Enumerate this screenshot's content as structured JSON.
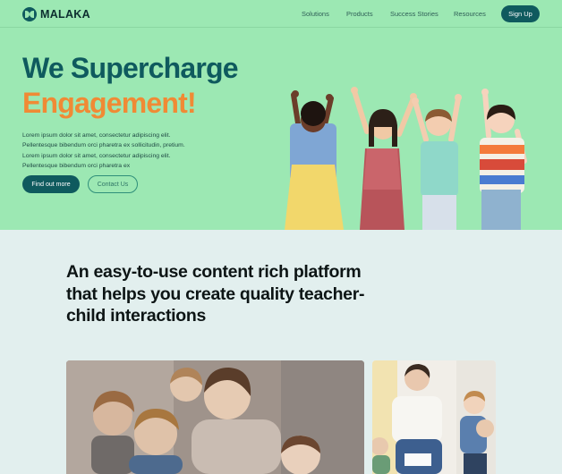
{
  "brand": {
    "name": "MALAKA"
  },
  "nav": {
    "links": [
      "Solutions",
      "Products",
      "Success Stories",
      "Resources"
    ],
    "signup_label": "Sign Up"
  },
  "hero": {
    "headline_line1": "We Supercharge",
    "headline_line2": "Engagement!",
    "body_lines": [
      "Lorem ipsum dolor sit amet, consectetur adipiscing elit.",
      "Pellentesque bibendum orci pharetra ex sollicitudin, pretium.",
      "Lorem ipsum dolor sit amet, consectetur adipiscing elit.",
      "Pellentesque bibendum orci pharetra ex"
    ],
    "primary_cta": "Find out more",
    "secondary_cta": "Contact Us"
  },
  "platform": {
    "heading": "An easy-to-use content rich platform that helps you create quality teacher-child interactions"
  },
  "colors": {
    "hero_bg": "#9ce8b3",
    "brand_teal": "#0f5a5e",
    "accent_orange": "#f08a35",
    "section_bg": "#e2efee"
  }
}
